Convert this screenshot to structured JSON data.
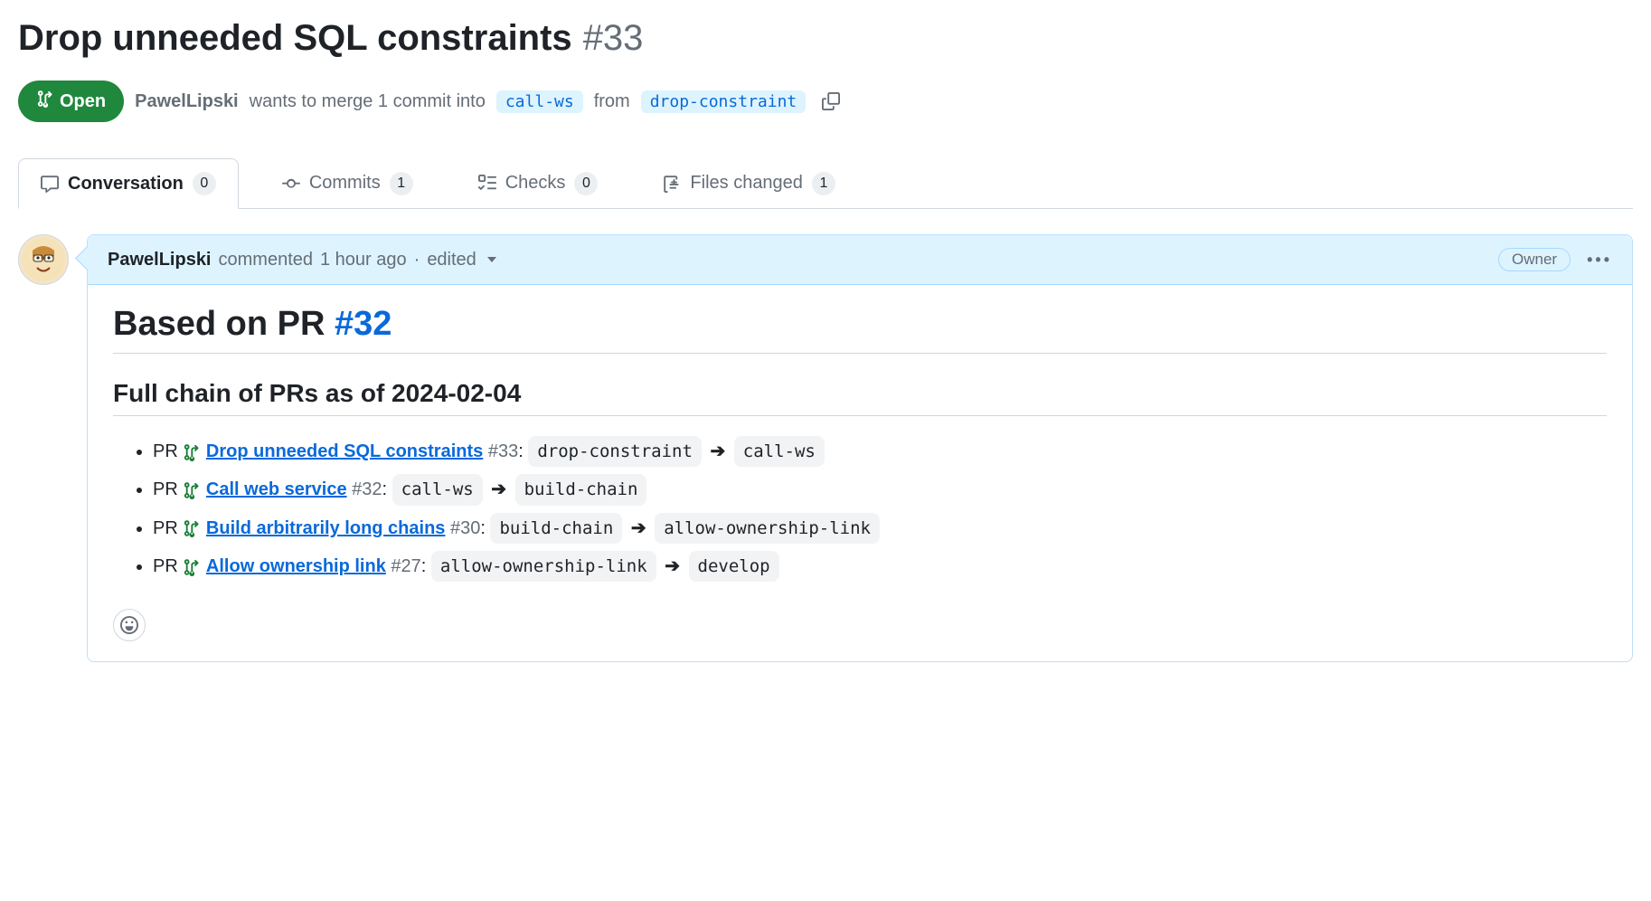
{
  "title": "Drop unneeded SQL constraints",
  "prNumber": "#33",
  "state": {
    "label": "Open"
  },
  "meta": {
    "author": "PawelLipski",
    "text1": "wants to merge 1 commit into",
    "baseBranch": "call-ws",
    "text2": "from",
    "headBranch": "drop-constraint"
  },
  "tabs": {
    "conversation": {
      "label": "Conversation",
      "count": "0"
    },
    "commits": {
      "label": "Commits",
      "count": "1"
    },
    "checks": {
      "label": "Checks",
      "count": "0"
    },
    "files": {
      "label": "Files changed",
      "count": "1"
    }
  },
  "comment": {
    "author": "PawelLipski",
    "verb": "commented",
    "time": "1 hour ago",
    "sep": "·",
    "edited": "edited",
    "ownerBadge": "Owner",
    "heading_prefix": "Based on PR ",
    "heading_link": "#32",
    "subheading": "Full chain of PRs as of 2024-02-04",
    "items": [
      {
        "prefix": "PR",
        "title": "Drop unneeded SQL constraints",
        "num": "#33",
        "from": "drop-constraint",
        "to": "call-ws"
      },
      {
        "prefix": "PR",
        "title": "Call web service",
        "num": "#32",
        "from": "call-ws",
        "to": "build-chain"
      },
      {
        "prefix": "PR",
        "title": "Build arbitrarily long chains",
        "num": "#30",
        "from": "build-chain",
        "to": "allow-ownership-link"
      },
      {
        "prefix": "PR",
        "title": "Allow ownership link",
        "num": "#27",
        "from": "allow-ownership-link",
        "to": "develop"
      }
    ]
  }
}
